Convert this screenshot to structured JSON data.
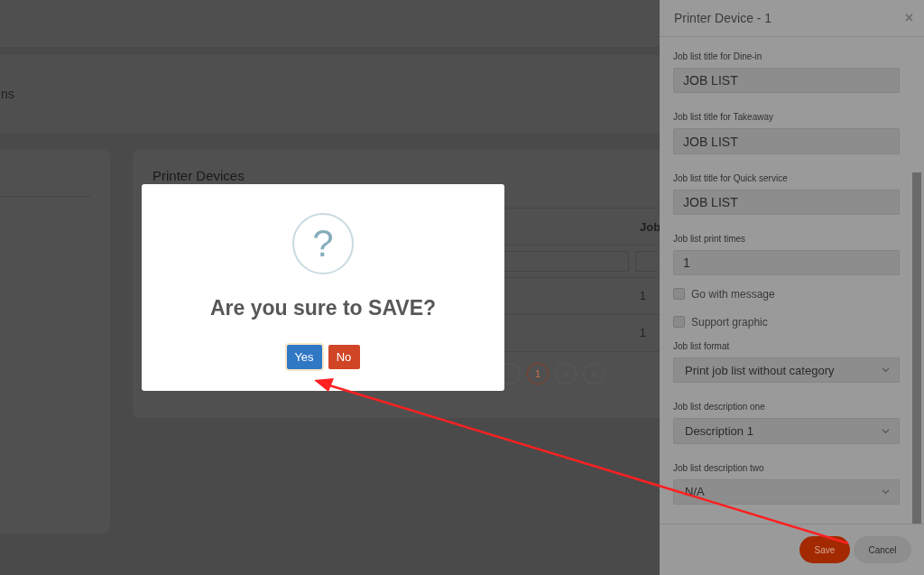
{
  "page": {
    "header_fragment": "ns"
  },
  "devices_card": {
    "title": "Printer Devices",
    "column_header": "Job",
    "rows": [
      {
        "cell": "1"
      },
      {
        "cell": "1"
      }
    ],
    "pages": [
      {
        "label": "1",
        "selected": true
      }
    ]
  },
  "drawer": {
    "title": "Printer Device - 1",
    "close": "×",
    "fields": [
      {
        "kind": "text",
        "label": "Job list title for Dine-in",
        "value": "JOB LIST"
      },
      {
        "kind": "text",
        "label": "Job list title for Takeaway",
        "value": "JOB LIST"
      },
      {
        "kind": "text",
        "label": "Job list title for Quick service",
        "value": "JOB LIST"
      },
      {
        "kind": "text",
        "label": "Job list print times",
        "value": "1"
      },
      {
        "kind": "checkbox",
        "label": "Go with message",
        "checked": false
      },
      {
        "kind": "checkbox",
        "label": "Support graphic",
        "checked": false
      },
      {
        "kind": "select",
        "label": "Job list format",
        "value": "Print job list without category"
      },
      {
        "kind": "select",
        "label": "Job list description one",
        "value": "Description 1"
      },
      {
        "kind": "select",
        "label": "Job list description two",
        "value": "N/A"
      }
    ],
    "buttons": [
      {
        "kind": "primary",
        "label": "Save"
      },
      {
        "kind": "secondary",
        "label": "Cancel"
      }
    ]
  },
  "dialog": {
    "icon": "?",
    "title": "Are you sure to SAVE?",
    "buttons": [
      {
        "kind": "confirm",
        "label": "Yes",
        "focused": true
      },
      {
        "kind": "cancel",
        "label": "No",
        "focused": false
      }
    ]
  }
}
